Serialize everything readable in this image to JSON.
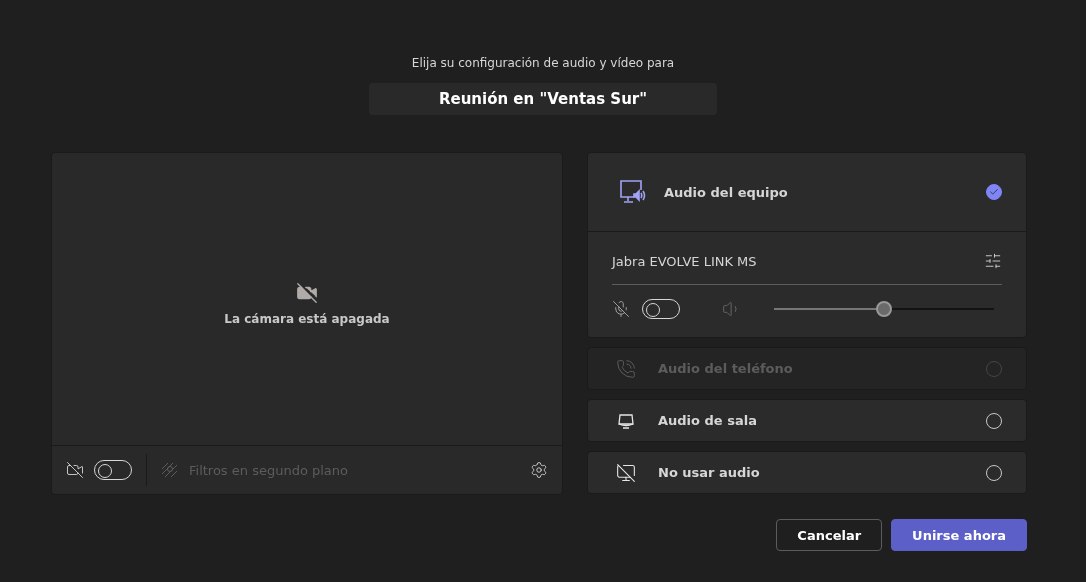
{
  "header": {
    "subtitle": "Elija su configuración de audio y vídeo para",
    "title": "Reunión en \"Ventas Sur\""
  },
  "preview": {
    "camera_off_text": "La cámara está apagada",
    "camera_on": false,
    "filters": {
      "label": "Filtros en segundo plano",
      "disabled": true
    }
  },
  "audio_options": [
    {
      "kind": "computer",
      "label": "Audio del equipo",
      "selected": true,
      "disabled": false,
      "device": {
        "name": "Jabra EVOLVE LINK MS",
        "mic_on": false,
        "volume": {
          "level": 0.5
        }
      }
    },
    {
      "kind": "phone",
      "label": "Audio del teléfono",
      "selected": false,
      "disabled": true
    },
    {
      "kind": "room",
      "label": "Audio de sala",
      "selected": false,
      "disabled": false
    },
    {
      "kind": "none",
      "label": "No usar audio",
      "selected": false,
      "disabled": false
    }
  ],
  "buttons": [
    {
      "kind": "secondary",
      "label": "Cancelar"
    },
    {
      "kind": "primary",
      "label": "Unirse ahora"
    }
  ]
}
